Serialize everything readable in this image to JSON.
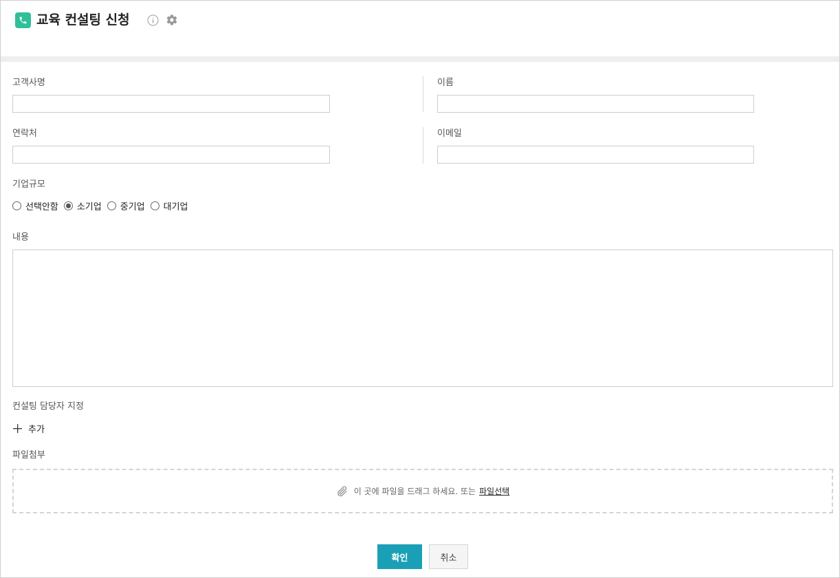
{
  "header": {
    "title": "교육 컨설팅 신청",
    "app_icon": "phone-icon",
    "info_icon": "info-icon",
    "settings_icon": "gear-icon",
    "accent_color": "#2fc09a"
  },
  "form": {
    "company_label": "고객사명",
    "company_value": "",
    "name_label": "이름",
    "name_value": "",
    "contact_label": "연락처",
    "contact_value": "",
    "email_label": "이메일",
    "email_value": "",
    "size_label": "기업규모",
    "size_options": [
      "선택안함",
      "소기업",
      "중기업",
      "대기업"
    ],
    "size_selected": "소기업",
    "content_label": "내용",
    "content_value": "",
    "assignee_label": "컨설팅 담당자 지정",
    "add_label": "추가",
    "attach_label": "파일첨부",
    "drop_text": "이 곳에 파일을 드래그 하세요. 또는",
    "file_select_label": "파일선택"
  },
  "buttons": {
    "confirm": "확인",
    "cancel": "취소",
    "confirm_color": "#1aa0b6"
  }
}
